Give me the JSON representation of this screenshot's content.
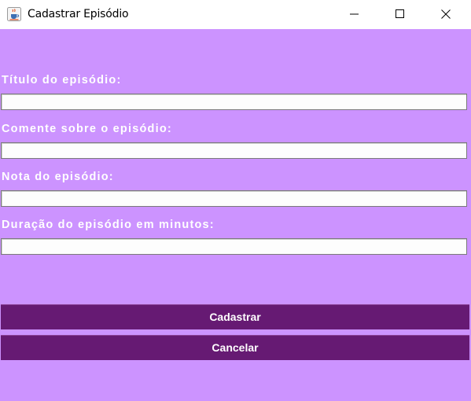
{
  "window": {
    "title": "Cadastrar Episódio",
    "icon": "java-coffee-cup-icon",
    "controls": [
      "minimize-icon",
      "maximize-icon",
      "close-icon"
    ]
  },
  "colors": {
    "background": "#cc93ff",
    "button": "#661a73",
    "label_text": "#ffffff"
  },
  "form": {
    "fields": [
      {
        "label": "Título do episódio:",
        "value": "",
        "placeholder": ""
      },
      {
        "label": "Comente sobre o episódio:",
        "value": "",
        "placeholder": ""
      },
      {
        "label": "Nota do episódio:",
        "value": "",
        "placeholder": ""
      },
      {
        "label": "Duração do episódio em minutos:",
        "value": "",
        "placeholder": ""
      }
    ],
    "submit_label": "Cadastrar",
    "cancel_label": "Cancelar"
  }
}
